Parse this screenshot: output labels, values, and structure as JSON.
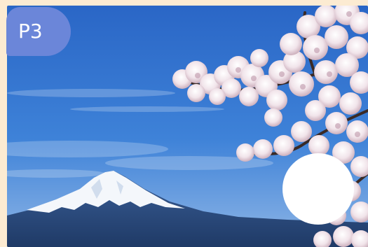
{
  "slide": {
    "badge_label": "P3",
    "image_icon": "fuji-cherry-blossom-photo",
    "marker_icon": "white-circle-marker",
    "colors": {
      "background": "#fcebd2",
      "badge": "#6b86d9",
      "sky": "#2f6fcc",
      "mountain": "#2d4f84"
    }
  }
}
